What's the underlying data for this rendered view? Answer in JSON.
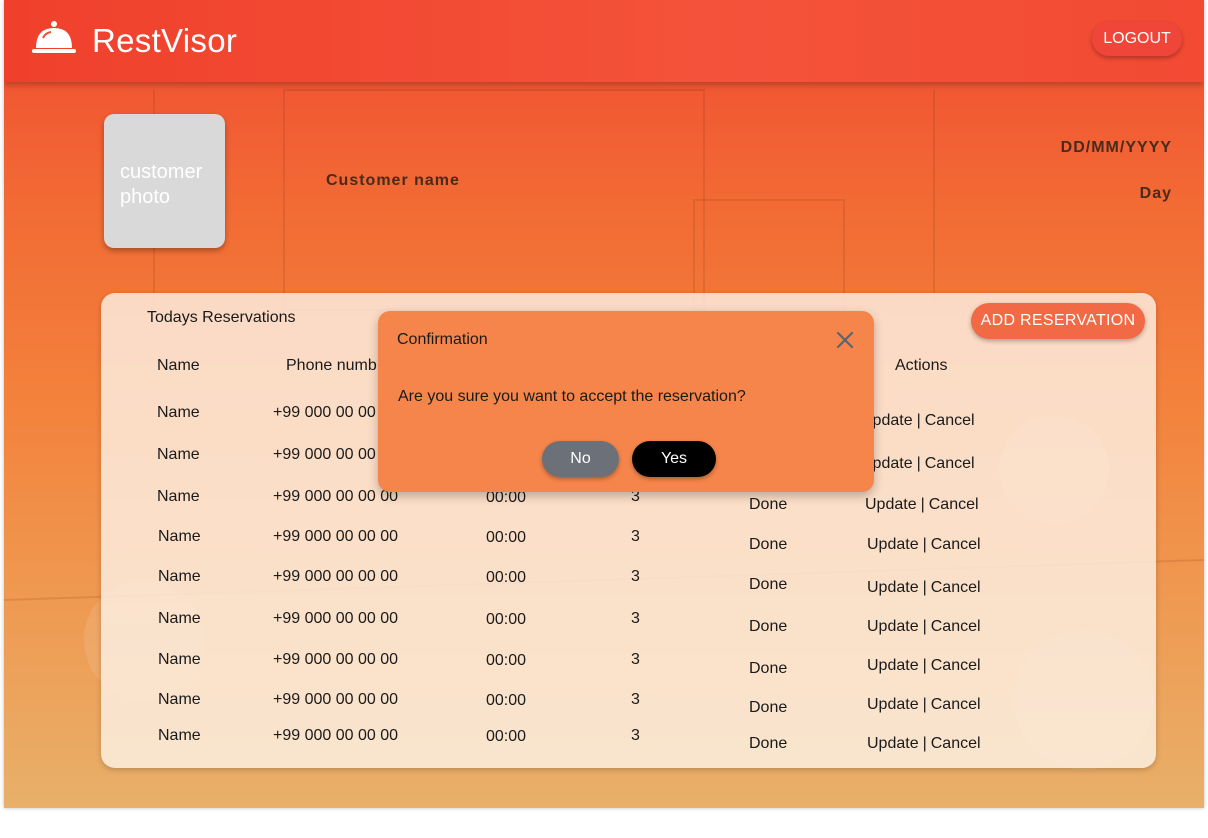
{
  "header": {
    "brand": "RestVisor",
    "logo_icon": "cloche-icon",
    "logout_label": "LOGOUT"
  },
  "profile": {
    "photo_placeholder": "customer\nphoto",
    "customer_name": "Customer name",
    "date": "DD/MM/YYYY",
    "day": "Day"
  },
  "reservations": {
    "title": "Todays Reservations",
    "add_button": "ADD RESERVATION",
    "columns": {
      "name": "Name",
      "phone": "Phone numb",
      "actions": "Actions"
    },
    "rows": [
      {
        "name": "Name",
        "phone": "+99 000 00 00",
        "time": "",
        "guests": "",
        "status": "",
        "update": "Update",
        "cancel": "Cancel"
      },
      {
        "name": "Name",
        "phone": "+99 000 00 00",
        "time": "",
        "guests": "",
        "status": "",
        "update": "Update",
        "cancel": "Cancel"
      },
      {
        "name": "Name",
        "phone": "+99 000 00 00 00",
        "time": "00:00",
        "guests": "3",
        "status": "Done",
        "update": "Update",
        "cancel": "Cancel"
      },
      {
        "name": "Name",
        "phone": "+99 000 00 00 00",
        "time": "00:00",
        "guests": "3",
        "status": "Done",
        "update": "Update",
        "cancel": "Cancel"
      },
      {
        "name": "Name",
        "phone": "+99 000 00 00 00",
        "time": "00:00",
        "guests": "3",
        "status": "Done",
        "update": "Update",
        "cancel": "Cancel"
      },
      {
        "name": "Name",
        "phone": "+99 000 00 00 00",
        "time": "00:00",
        "guests": "3",
        "status": "Done",
        "update": "Update",
        "cancel": "Cancel"
      },
      {
        "name": "Name",
        "phone": "+99 000 00 00 00",
        "time": "00:00",
        "guests": "3",
        "status": "Done",
        "update": "Update",
        "cancel": "Cancel"
      },
      {
        "name": "Name",
        "phone": "+99 000 00 00 00",
        "time": "00:00",
        "guests": "3",
        "status": "Done",
        "update": "Update",
        "cancel": "Cancel"
      },
      {
        "name": "Name",
        "phone": "+99 000 00 00 00",
        "time": "00:00",
        "guests": "3",
        "status": "Done",
        "update": "Update",
        "cancel": "Cancel"
      }
    ],
    "action_separator": "|"
  },
  "dialog": {
    "title": "Confirmation",
    "close_icon": "close-icon",
    "message": "Are you sure you want to accept the reservation?",
    "no_label": "No",
    "yes_label": "Yes"
  }
}
